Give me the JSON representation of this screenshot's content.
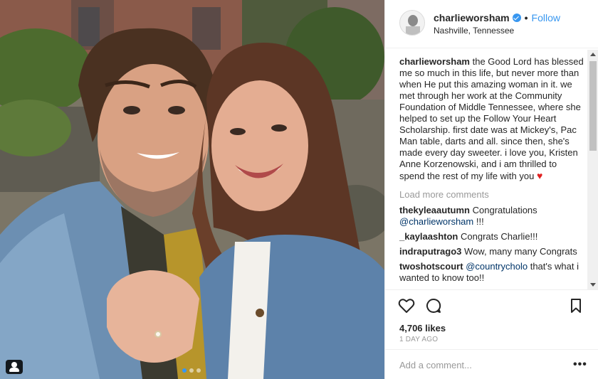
{
  "post": {
    "username": "charlieworsham",
    "follow_label": "Follow",
    "separator": "•",
    "location": "Nashville, Tennessee",
    "caption_user": "charlieworsham",
    "caption_text": "the Good Lord has blessed me so much in this life, but never more than when He put this amazing woman in it. we met through her work at the Community Foundation of Middle Tennessee, where she helped to set up the Follow Your Heart Scholarship. first date was at Mickey's, Pac Man table, darts and all. since then, she's made every day sweeter. i love you, Kristen Anne Korzenowski, and i am thrilled to spend the rest of my life with you",
    "caption_emoji": "♥",
    "load_more": "Load more comments",
    "comments": [
      {
        "user": "thekyleaautumn",
        "text": "Congratulations",
        "mention": "@charlieworsham",
        "suffix": "!!!"
      },
      {
        "user": "_kaylaashton",
        "text": "Congrats Charlie!!!"
      },
      {
        "user": "indraputrago3",
        "text": "Wow, many many Congrats"
      },
      {
        "user": "twoshotscourt",
        "mention": "@countrycholo",
        "text": "that's what i wanted to know too!!"
      }
    ],
    "likes": "4,706 likes",
    "time_ago": "1 DAY AGO",
    "add_comment_placeholder": "Add a comment...",
    "more_label": "•••"
  },
  "icons": {
    "like": "heart-outline-icon",
    "comment": "speech-bubble-icon",
    "save": "bookmark-icon",
    "tag": "user-tag-icon",
    "verified": "verified-badge-icon"
  },
  "colors": {
    "link": "#3897f0",
    "heart": "#e02020",
    "muted": "#999999",
    "text": "#262626"
  },
  "carousel": {
    "count": 3,
    "active": 1
  }
}
